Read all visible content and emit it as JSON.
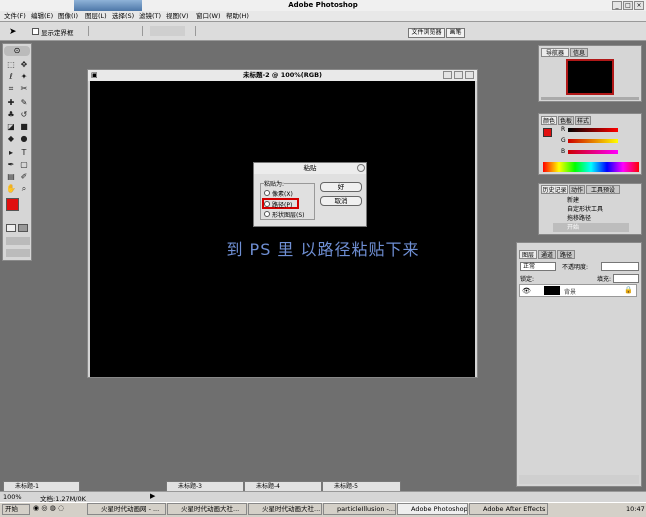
{
  "app": {
    "title": "Adobe Photoshop"
  },
  "menu": [
    "文件(F)",
    "编辑(E)",
    "图像(I)",
    "图层(L)",
    "选择(S)",
    "滤镜(T)",
    "视图(V)",
    "窗口(W)",
    "帮助(H)"
  ],
  "options": {
    "show_bounding_box": "显示定界框"
  },
  "palette_tabs": {
    "file_browser": "文件浏览器",
    "brushes": "画笔"
  },
  "document": {
    "title": "未标题-2 @ 100%(RGB)"
  },
  "dialog": {
    "title": "粘贴",
    "group_label": "粘贴为:",
    "option_pixels": "像素(X)",
    "option_path": "路径(P)",
    "option_shape": "形状图层(S)",
    "ok": "好",
    "cancel": "取消"
  },
  "caption": "到 PS 里 以路径粘贴下来",
  "navigator": {
    "tabs": [
      "导航器",
      "信息"
    ]
  },
  "color": {
    "tabs": [
      "颜色",
      "色板",
      "样式"
    ],
    "channels": [
      "R",
      "G",
      "B"
    ],
    "fg_color": "#e01010"
  },
  "history": {
    "tabs": [
      "历史记录",
      "动作",
      "工具预设"
    ],
    "items": [
      "新建",
      "自定形状工具",
      "拖移路径",
      "开始"
    ]
  },
  "layers": {
    "tabs": [
      "图层",
      "通道",
      "路径"
    ],
    "mode": "正常",
    "opacity_label": "不透明度:",
    "lock_label": "锁定:",
    "fill_label": "填充:",
    "layer_name": "背景"
  },
  "minimized": [
    "未标题-1",
    "未标题-3",
    "未标题-4",
    "未标题-5"
  ],
  "status": {
    "zoom": "100%",
    "doc": "文档:1.27M/0K"
  },
  "taskbar": {
    "start": "开始",
    "tasks": [
      "火星时代动画网 - ...",
      "火星时代动画大社...",
      "火星时代动画大社...",
      "particleIllusion -...",
      "Adobe Photoshop",
      "Adobe After Effects"
    ],
    "clock": "10:47"
  }
}
